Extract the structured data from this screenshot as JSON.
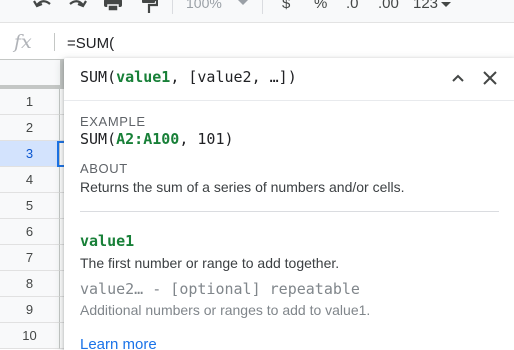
{
  "toolbar": {
    "zoom": "100%",
    "currency_label": "$",
    "percent_label": "%",
    "decrease_decimals_label": ".0",
    "increase_decimals_label": ".00",
    "more_formats_label": "123"
  },
  "formula_bar": {
    "fx_label": "fx",
    "value": "=SUM("
  },
  "rows": [
    "1",
    "2",
    "3",
    "4",
    "5",
    "6",
    "7",
    "8",
    "9",
    "10"
  ],
  "tooltip": {
    "sig_fn": "SUM(",
    "sig_arg1": "value1",
    "sig_rest": ", [value2, …])",
    "example_label": "EXAMPLE",
    "example_fn": "SUM(",
    "example_range": "A2:A100",
    "example_rest": ", 101)",
    "about_label": "ABOUT",
    "about_text": "Returns the sum of a series of numbers and/or cells.",
    "arg1_name": "value1",
    "arg1_desc": "The first number or range to add together.",
    "arg2_name": "value2… - [optional] repeatable",
    "arg2_desc": "Additional numbers or ranges to add to value1.",
    "learn_more": "Learn more"
  },
  "colors": {
    "accent_blue": "#1a73e8",
    "arg_green": "#188038",
    "selected_row_bg": "#d3e3fd"
  },
  "icons": [
    "undo-icon",
    "redo-icon",
    "print-icon",
    "paint-format-icon",
    "chevron-down-icon",
    "chevron-up-icon",
    "close-icon"
  ]
}
